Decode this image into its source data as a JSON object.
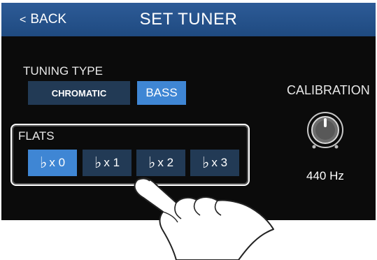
{
  "header": {
    "back_label": "BACK",
    "back_icon": "chevron-left-icon",
    "title": "SET TUNER"
  },
  "tuning_type": {
    "label": "TUNING TYPE",
    "options": [
      {
        "label": "CHROMATIC",
        "selected": false
      },
      {
        "label": "BASS",
        "selected": true
      }
    ]
  },
  "flats": {
    "label": "FLATS",
    "symbol": "♭",
    "options": [
      {
        "label": "x 0",
        "selected": true
      },
      {
        "label": "x 1",
        "selected": false
      },
      {
        "label": "x 2",
        "selected": false
      },
      {
        "label": "x 3",
        "selected": false
      }
    ]
  },
  "calibration": {
    "label": "CALIBRATION",
    "value": "440 Hz",
    "knob_icon": "knob-icon"
  },
  "colors": {
    "title_bar": "#1f4a80",
    "button_dark": "#223a55",
    "button_selected": "#3f86d4",
    "screen_bg": "#0b0b0b"
  }
}
